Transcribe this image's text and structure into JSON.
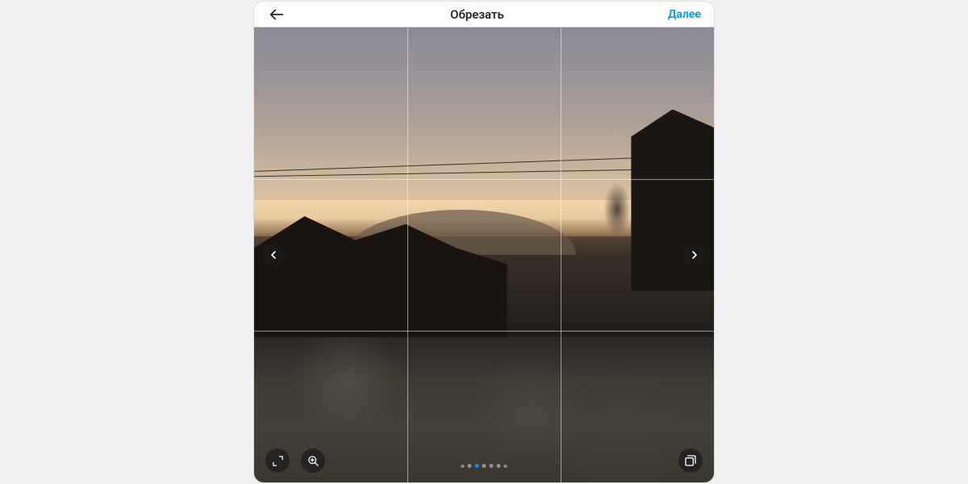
{
  "header": {
    "title": "Обрезать",
    "next_label": "Далее"
  },
  "carousel": {
    "total_items": 7,
    "active_index": 2
  },
  "controls": {
    "expand": "expand-icon",
    "zoom": "zoom-icon",
    "multi_select": "multi-select-icon"
  },
  "colors": {
    "accent": "#0095f6"
  }
}
